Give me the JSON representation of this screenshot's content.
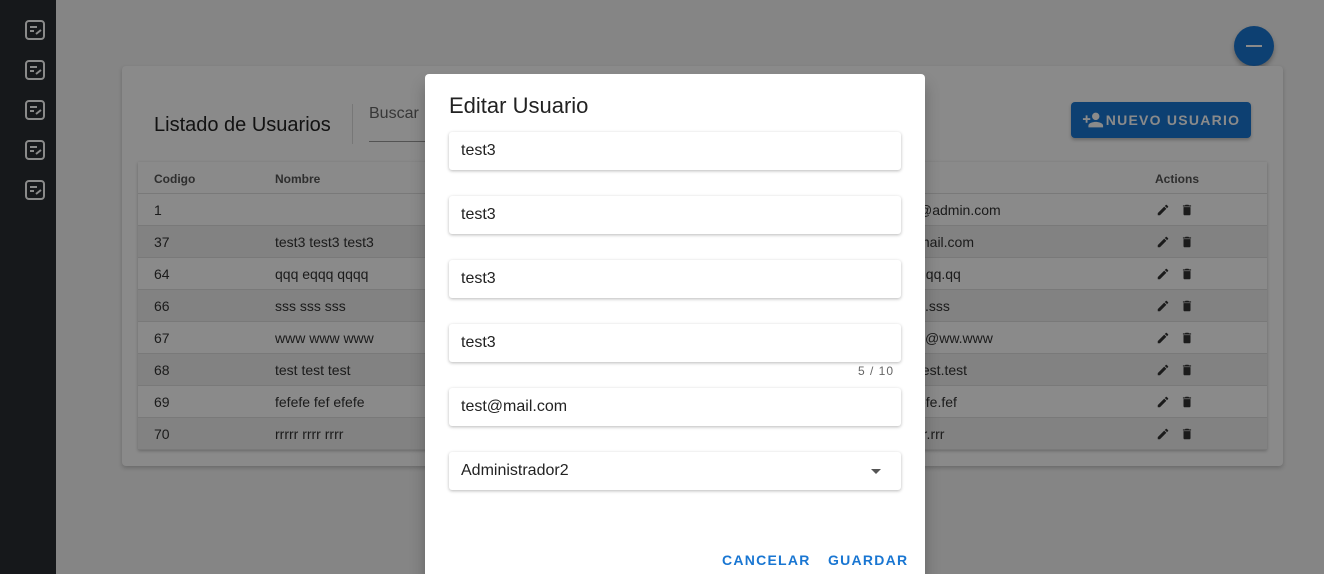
{
  "sidebar": {
    "icons": [
      "note-icon",
      "note-icon",
      "note-icon",
      "note-icon",
      "note-icon"
    ]
  },
  "fab": {
    "icon": "minus-icon"
  },
  "card": {
    "title": "Listado de Usuarios",
    "search_label": "Buscar",
    "new_button_label": "NUEVO USUARIO"
  },
  "table": {
    "headers": {
      "codigo": "Codigo",
      "nombre": "Nombre",
      "actions": "Actions"
    },
    "rows": [
      {
        "codigo": "1",
        "nombre": "",
        "email": "@admin.com"
      },
      {
        "codigo": "37",
        "nombre": "test3 test3 test3",
        "email": "mail.com"
      },
      {
        "codigo": "64",
        "nombre": "qqq eqqq qqqq",
        "email": "qqq.qq"
      },
      {
        "codigo": "66",
        "nombre": "sss sss sss",
        "email": "s.sss"
      },
      {
        "codigo": "67",
        "nombre": "www www www",
        "email": "v@ww.www"
      },
      {
        "codigo": "68",
        "nombre": "test test test",
        "email": "test.test"
      },
      {
        "codigo": "69",
        "nombre": "fefefe fef efefe",
        "email": "efe.fef"
      },
      {
        "codigo": "70",
        "nombre": "rrrrr rrrr rrrr",
        "email": "rr.rrr"
      }
    ]
  },
  "dialog": {
    "title": "Editar Usuario",
    "fields": [
      "test3",
      "test3",
      "test3",
      "test3",
      "test@mail.com"
    ],
    "counter": "5 / 10",
    "role_value": "Administrador2",
    "cancel_label": "CANCELAR",
    "save_label": "GUARDAR"
  },
  "colors": {
    "primary": "#1976d2",
    "sidebar": "#2a2e33"
  }
}
